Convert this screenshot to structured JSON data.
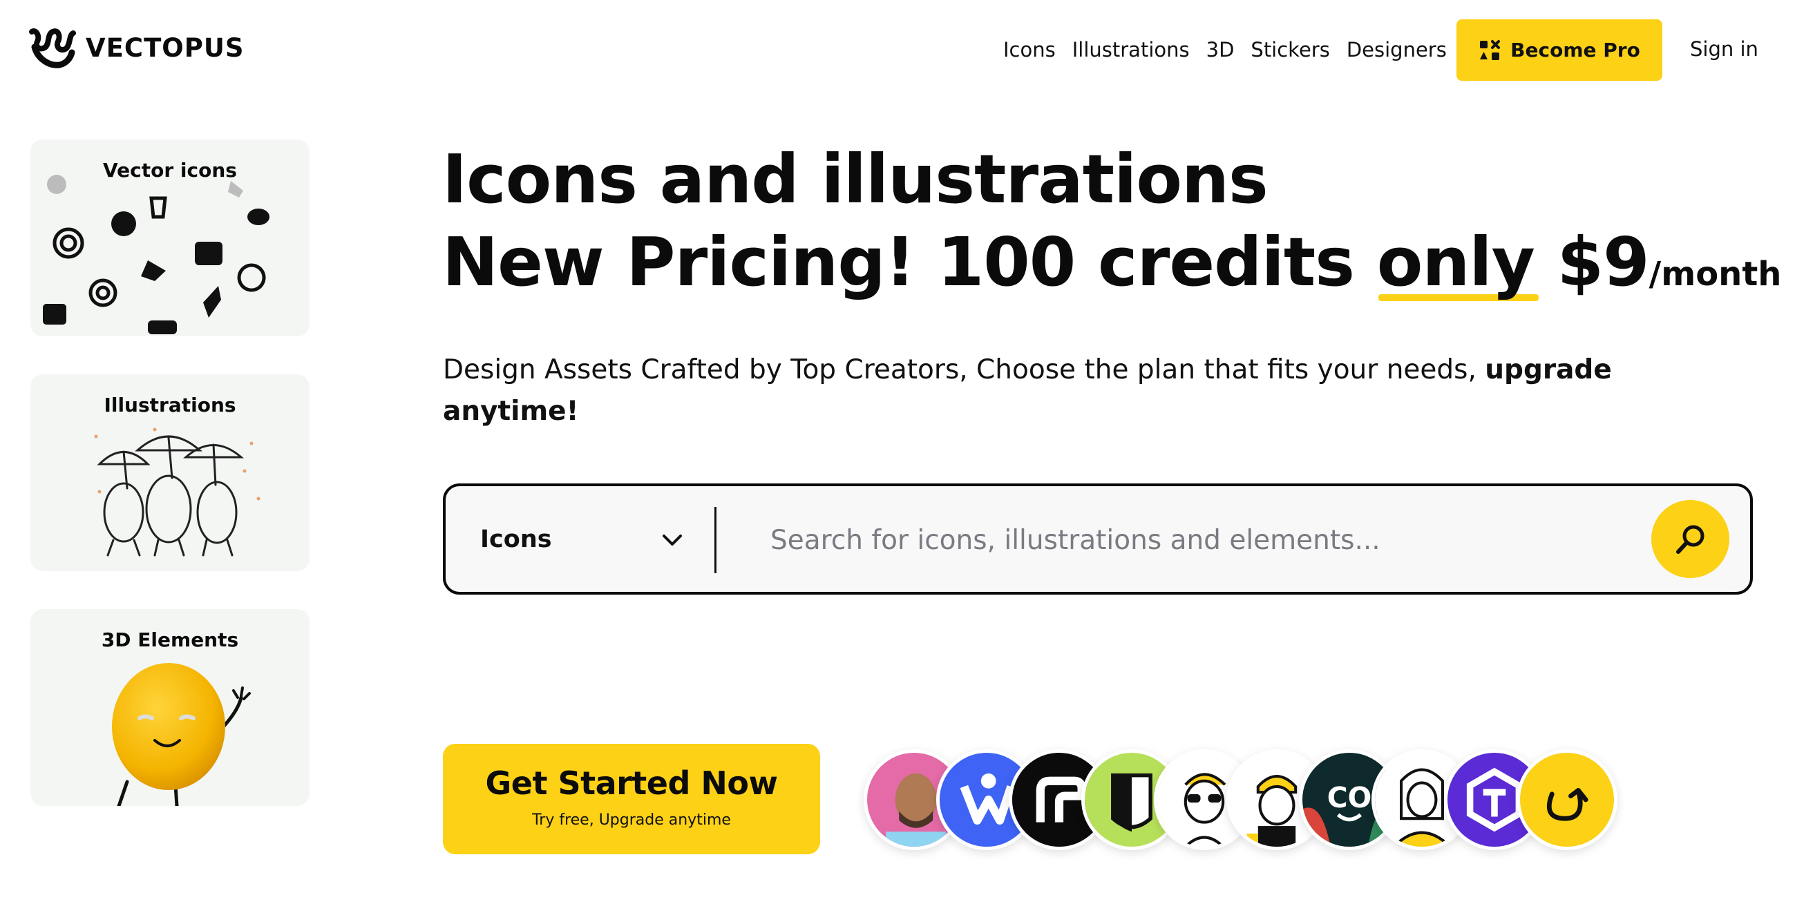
{
  "brand": {
    "name": "VECTOPUS",
    "accent": "#FCD116"
  },
  "nav": {
    "links": [
      "Icons",
      "Illustrations",
      "3D",
      "Stickers",
      "Designers"
    ],
    "pro_label": "Become Pro",
    "signin_label": "Sign in"
  },
  "sidebar": {
    "cards": [
      {
        "title": "Vector icons"
      },
      {
        "title": "Illustrations"
      },
      {
        "title": "3D Elements"
      }
    ]
  },
  "hero": {
    "line1": "Icons and illustrations",
    "line2_a": "New Pricing! 100 credits ",
    "line2_only": "only",
    "line2_price": " $9",
    "line2_per": "/month",
    "subtitle_text": "Design Assets Crafted by Top Creators, Choose the plan that fits your needs, ",
    "subtitle_bold": "upgrade anytime!"
  },
  "search": {
    "category": "Icons",
    "placeholder": "Search for icons, illustrations and elements..."
  },
  "cta": {
    "main": "Get Started Now",
    "sub": "Try free, Upgrade anytime"
  },
  "designers": {
    "avatar_count": 10
  }
}
